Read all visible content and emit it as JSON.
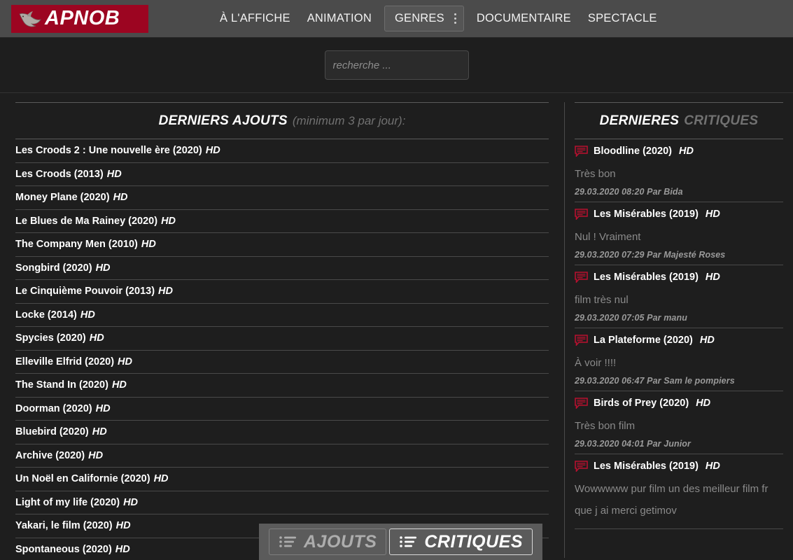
{
  "brand": {
    "name": "APNOB",
    "logo_icon": "dolphin-icon",
    "logo_bg": "#9c0521"
  },
  "nav": {
    "items": [
      {
        "label": "À L'AFFICHE",
        "boxed": false,
        "icon": null
      },
      {
        "label": "ANIMATION",
        "boxed": false,
        "icon": null
      },
      {
        "label": "GENRES",
        "boxed": true,
        "icon": "kebab-menu-icon"
      },
      {
        "label": "DOCUMENTAIRE",
        "boxed": false,
        "icon": null
      },
      {
        "label": "SPECTACLE",
        "boxed": false,
        "icon": null
      }
    ]
  },
  "search": {
    "placeholder": "recherche ...",
    "value": ""
  },
  "additions_panel": {
    "title_strong": "DERNIERS AJOUTS",
    "title_muted": "(minimum 3 par jour):",
    "items": [
      {
        "title": "Les Croods 2 : Une nouvelle ère (2020)",
        "quality": "HD"
      },
      {
        "title": "Les Croods (2013)",
        "quality": "HD"
      },
      {
        "title": "Money Plane (2020)",
        "quality": "HD"
      },
      {
        "title": "Le Blues de Ma Rainey (2020)",
        "quality": "HD"
      },
      {
        "title": "The Company Men (2010)",
        "quality": "HD"
      },
      {
        "title": "Songbird (2020)",
        "quality": "HD"
      },
      {
        "title": "Le Cinquième Pouvoir (2013)",
        "quality": "HD"
      },
      {
        "title": "Locke (2014)",
        "quality": "HD"
      },
      {
        "title": "Spycies (2020)",
        "quality": "HD"
      },
      {
        "title": "Elleville Elfrid (2020)",
        "quality": "HD"
      },
      {
        "title": "The Stand In (2020)",
        "quality": "HD"
      },
      {
        "title": "Doorman (2020)",
        "quality": "HD"
      },
      {
        "title": "Bluebird (2020)",
        "quality": "HD"
      },
      {
        "title": "Archive (2020)",
        "quality": "HD"
      },
      {
        "title": "Un Noël en Californie (2020)",
        "quality": "HD"
      },
      {
        "title": "Light of my life (2020)",
        "quality": "HD"
      },
      {
        "title": "Yakari, le film (2020)",
        "quality": "HD"
      },
      {
        "title": "Spontaneous (2020)",
        "quality": "HD"
      }
    ]
  },
  "reviews_panel": {
    "title_strong": "DERNIERES",
    "title_muted": "CRITIQUES",
    "comment_icon": "comment-bubble-icon",
    "comment_icon_color": "#b8102f",
    "items": [
      {
        "movie": "Bloodline (2020)",
        "quality": "HD",
        "body": "Très bon",
        "meta": "29.03.2020 08:20 Par Bida"
      },
      {
        "movie": "Les Misérables (2019)",
        "quality": "HD",
        "body": "Nul ! Vraiment",
        "meta": "29.03.2020 07:29 Par Majesté Roses"
      },
      {
        "movie": "Les Misérables (2019)",
        "quality": "HD",
        "body": "film très nul",
        "meta": "29.03.2020 07:05 Par manu"
      },
      {
        "movie": "La Plateforme (2020)",
        "quality": "HD",
        "body": "À voir !!!!",
        "meta": "29.03.2020 06:47 Par Sam le pompiers"
      },
      {
        "movie": "Birds of Prey (2020)",
        "quality": "HD",
        "body": "Très bon film",
        "meta": "29.03.2020 04:01 Par Junior"
      },
      {
        "movie": "Les Misérables (2019)",
        "quality": "HD",
        "body": "Wowwwww pur film un des meilleur film fr que j ai merci getimov",
        "meta": ""
      }
    ]
  },
  "floating_bar": {
    "buttons": [
      {
        "label": "AJOUTS",
        "icon": "bulleted-list-icon",
        "state": "dim"
      },
      {
        "label": "CRITIQUES",
        "icon": "bulleted-list-icon",
        "state": "bright"
      }
    ]
  },
  "theme": {
    "page_bg": "#1e1e1e",
    "topbar_bg": "#4b4b4b",
    "accent_red": "#9c0521",
    "divider": "#4a4a4a"
  }
}
